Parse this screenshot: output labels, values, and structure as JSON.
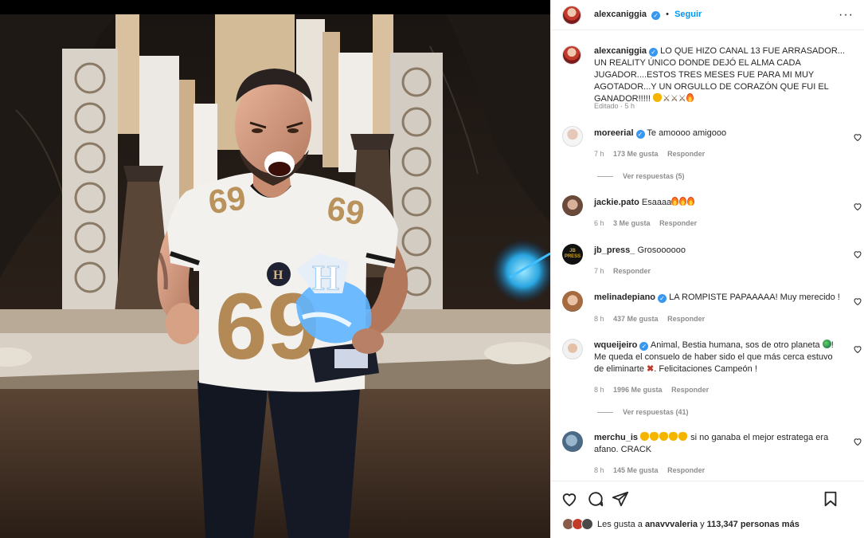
{
  "post": {
    "author": "alexcaniggia",
    "follow_label": "Seguir",
    "dot": "•",
    "more_label": "···",
    "caption_author": "alexcaniggia",
    "caption_text": "LO QUE HIZO CANAL 13 FUE ARRASADOR... UN REALITY ÚNICO DONDE DEJÓ EL ALMA CADA JUGADOR....ESTOS TRES MESES FUE PARA MI MUY AGOTADOR...Y UN ORGULLO DE CORAZÓN QUE FUI EL GANADOR!!!!!",
    "caption_meta": "Editado · 5 h"
  },
  "photo": {
    "jersey_number": "69",
    "trophy_letter": "H"
  },
  "comments": [
    {
      "user": "moreerial",
      "text": "Te amoooo amigooo",
      "time": "7 h",
      "likes": "173 Me gusta",
      "reply": "Responder",
      "view_replies": "Ver respuestas (5)"
    },
    {
      "user": "jackie.pato",
      "text": "Esaaaa",
      "time": "6 h",
      "likes": "3 Me gusta",
      "reply": "Responder"
    },
    {
      "user": "jb_press_",
      "text": "Grosoooooo",
      "time": "7 h",
      "reply": "Responder",
      "avatar_text": "JB PRESS"
    },
    {
      "user": "melinadepiano",
      "text": "LA ROMPISTE PAPAAAAA! Muy merecido !",
      "time": "8 h",
      "likes": "437 Me gusta",
      "reply": "Responder"
    },
    {
      "user": "wqueijeiro",
      "text_a": "Animal, Bestia humana, sos de otro planeta",
      "text_b": "! Me queda el consuelo de haber sido el que más cerca estuvo de eliminarte",
      "text_c": ". Felicitaciones Campeón !",
      "time": "8 h",
      "likes": "1996 Me gusta",
      "reply": "Responder",
      "view_replies": "Ver respuestas (41)"
    },
    {
      "user": "merchu_is",
      "text": "si no ganaba el mejor estratega era afano. CRACK",
      "time": "8 h",
      "likes": "145 Me gusta",
      "reply": "Responder"
    }
  ],
  "likes_bar": {
    "prefix": "Les gusta a",
    "user": "anavvvaleria",
    "middle": "y",
    "count": "113,347 personas más"
  },
  "icons": {
    "verified": "verified-badge",
    "heart": "heart-icon",
    "comment": "comment-icon",
    "share": "share-icon",
    "save": "bookmark-icon",
    "more": "more-options-icon"
  },
  "colors": {
    "accent": "#0095f6",
    "verified": "#3897f0",
    "muted": "#8e8e8e",
    "text": "#262626"
  }
}
